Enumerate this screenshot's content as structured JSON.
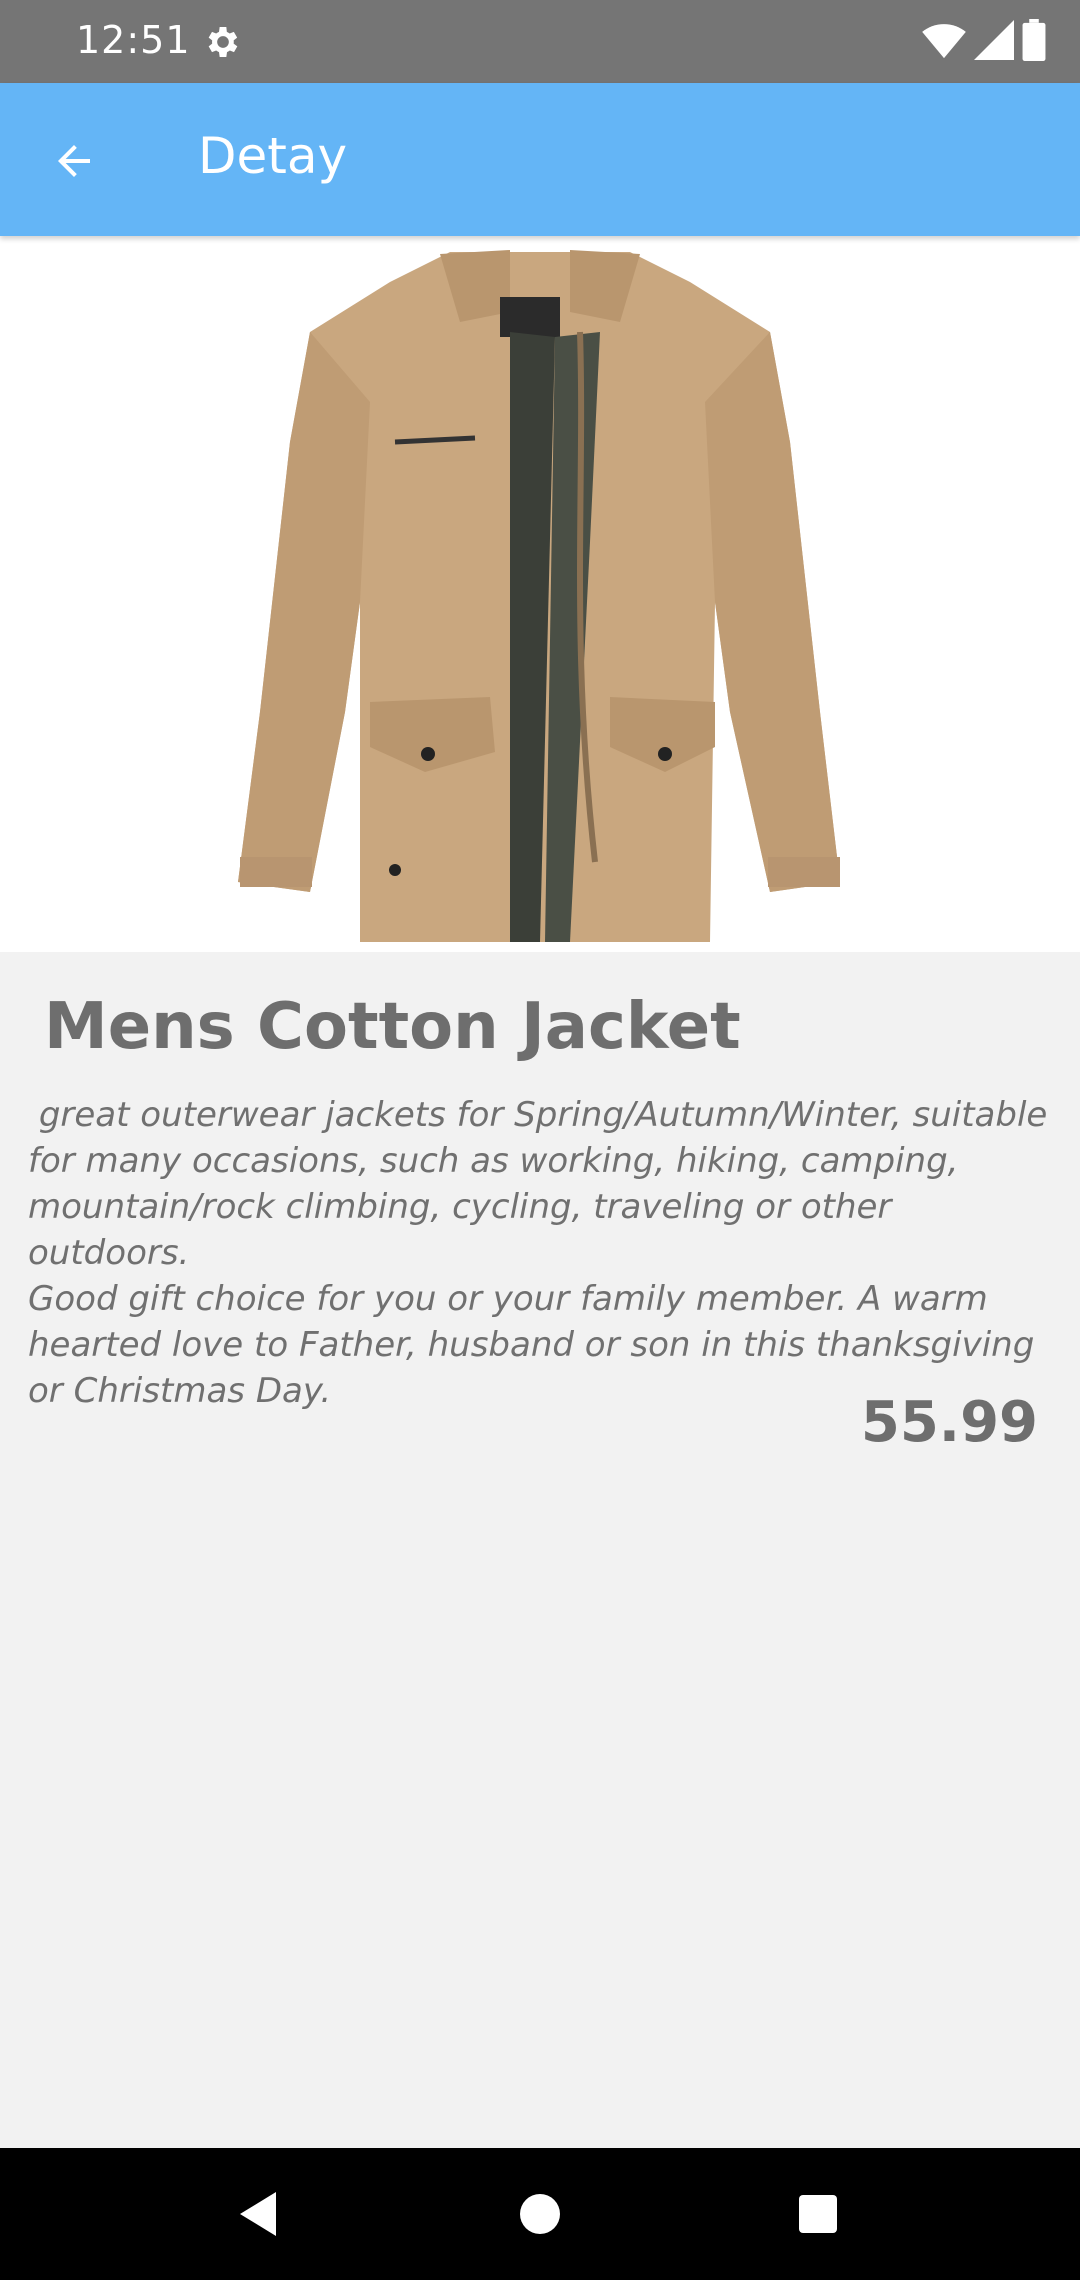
{
  "status_bar": {
    "time": "12:51",
    "icons": [
      "gear-icon",
      "wifi-icon",
      "signal-icon",
      "battery-icon"
    ]
  },
  "app_bar": {
    "title": "Detay",
    "back_icon": "arrow-left-icon",
    "color": "#64b5f6"
  },
  "product": {
    "image_alt": "khaki cotton jacket",
    "title": "Mens Cotton Jacket",
    "description": " great outerwear jackets for Spring/Autumn/Winter, suitable\nfor many occasions, such as working, hiking, camping,\nmountain/rock climbing, cycling, traveling or other outdoors.\nGood gift choice for you or your family member. A warm\nhearted love to Father, husband or son in this thanksgiving\nor Christmas Day.",
    "price": "55.99"
  },
  "nav_bar": {
    "buttons": [
      "back-triangle-icon",
      "home-circle-icon",
      "recents-square-icon"
    ]
  }
}
